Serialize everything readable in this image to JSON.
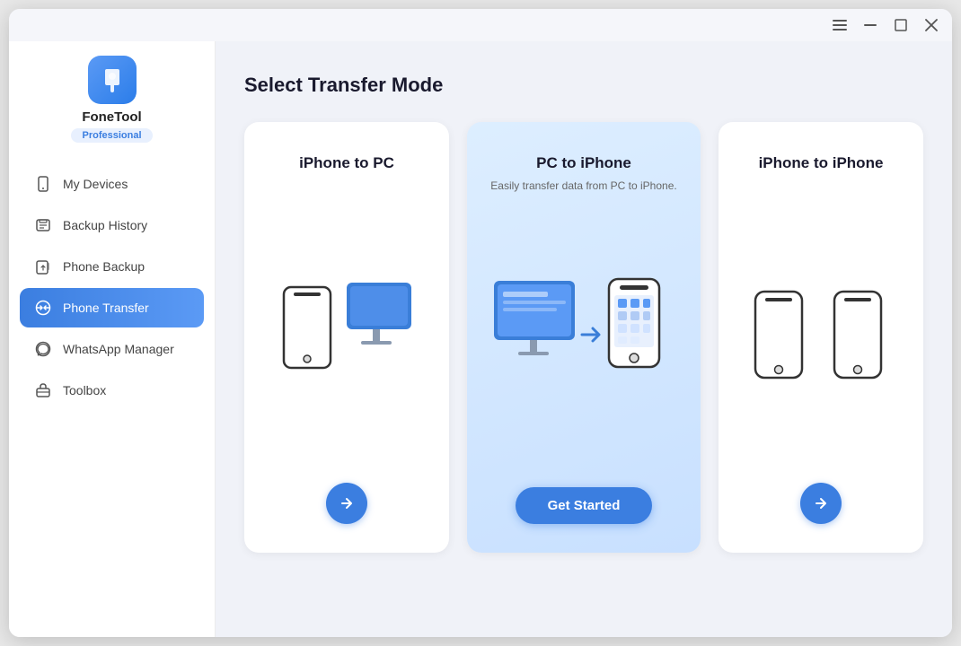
{
  "window": {
    "title": "FoneTool",
    "titlebar_buttons": [
      "menu",
      "minimize",
      "maximize",
      "close"
    ]
  },
  "sidebar": {
    "app_name": "FoneTool",
    "badge": "Professional",
    "nav_items": [
      {
        "id": "devices",
        "label": "My Devices",
        "icon": "phone-icon",
        "active": false
      },
      {
        "id": "backup-history",
        "label": "Backup History",
        "icon": "history-icon",
        "active": false
      },
      {
        "id": "phone-backup",
        "label": "Phone Backup",
        "icon": "backup-icon",
        "active": false
      },
      {
        "id": "phone-transfer",
        "label": "Phone Transfer",
        "icon": "transfer-icon",
        "active": true
      },
      {
        "id": "whatsapp",
        "label": "WhatsApp Manager",
        "icon": "whatsapp-icon",
        "active": false
      },
      {
        "id": "toolbox",
        "label": "Toolbox",
        "icon": "toolbox-icon",
        "active": false
      }
    ]
  },
  "content": {
    "page_title": "Select Transfer Mode",
    "cards": [
      {
        "id": "iphone-to-pc",
        "title": "iPhone to PC",
        "subtitle": "",
        "action_type": "arrow"
      },
      {
        "id": "pc-to-iphone",
        "title": "PC to iPhone",
        "subtitle": "Easily transfer data from PC to iPhone.",
        "action_type": "get-started",
        "action_label": "Get Started"
      },
      {
        "id": "iphone-to-iphone",
        "title": "iPhone to iPhone",
        "subtitle": "",
        "action_type": "arrow"
      }
    ]
  }
}
